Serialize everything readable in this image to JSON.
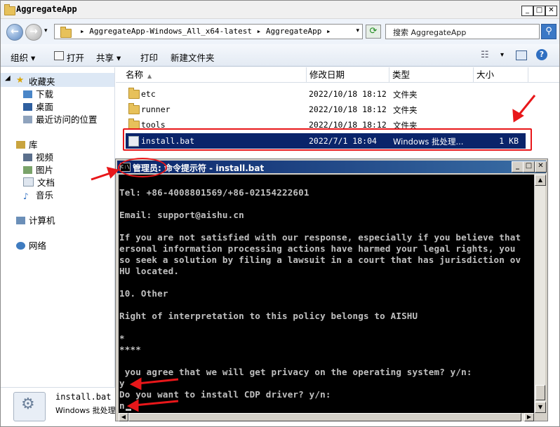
{
  "explorer": {
    "title": "AggregateApp",
    "address": "▸ AggregateApp-Windows_All_x64-latest ▸ AggregateApp ▸",
    "search_placeholder": "搜索 AggregateApp",
    "toolbar": [
      "组织 ▾",
      "打开",
      "共享 ▾",
      "打印",
      "新建文件夹"
    ],
    "sidebar": {
      "favorites_label": "收藏夹",
      "favorites": [
        "下载",
        "桌面",
        "最近访问的位置"
      ],
      "libraries_label": "库",
      "libraries": [
        "视频",
        "图片",
        "文档",
        "音乐"
      ],
      "computer": "计算机",
      "network": "网络"
    },
    "columns": [
      "名称",
      "修改日期",
      "类型",
      "大小"
    ],
    "files": [
      {
        "name": "etc",
        "date": "2022/10/18 18:12",
        "type": "文件夹",
        "size": ""
      },
      {
        "name": "runner",
        "date": "2022/10/18 18:12",
        "type": "文件夹",
        "size": ""
      },
      {
        "name": "tools",
        "date": "2022/10/18 18:12",
        "type": "文件夹",
        "size": ""
      },
      {
        "name": "install.bat",
        "date": "2022/7/1 18:04",
        "type": "Windows 批处理...",
        "size": "1 KB"
      }
    ],
    "details": {
      "name": "install.bat",
      "type": "Windows 批处理"
    }
  },
  "cmd": {
    "title_admin": "管理员:",
    "title_rest": "命令提示符 - install.bat",
    "lines": [
      "Tel: +86-4008801569/+86-02154222601",
      "",
      "Email: support@aishu.cn",
      "",
      "If you are not satisfied with our response, especially if you believe that",
      "ersonal information processing actions have harmed your legal rights, you",
      "so seek a solution by filing a lawsuit in a court that has jurisdiction ov",
      "HU located.",
      "",
      "10. Other",
      "",
      "Right of interpretation to this policy belongs to AISHU",
      "",
      "*",
      "****",
      "",
      " you agree that we will get privacy on the operating system? y/n:",
      "y",
      "Do you want to install CDP driver? y/n:",
      "n"
    ]
  }
}
